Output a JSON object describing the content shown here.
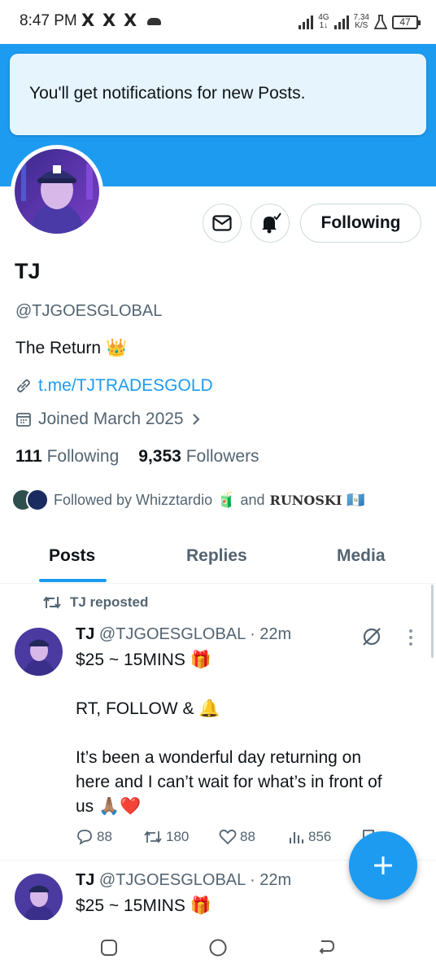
{
  "status_bar": {
    "time": "8:47 PM",
    "app_icons": [
      "X",
      "X",
      "X"
    ],
    "network_top": "4G",
    "network_bottom": "1↓",
    "speed_value": "7.34",
    "speed_unit": "K/S",
    "battery": "47"
  },
  "toast": {
    "text": "You'll get notifications for new Posts."
  },
  "actions": {
    "following_label": "Following"
  },
  "profile": {
    "name": "TJ",
    "handle": "@TJGOESGLOBAL",
    "bio": "The Return",
    "bio_emoji": "👑",
    "link": "t.me/TJTRADESGOLD",
    "joined": "Joined March 2025",
    "following_count": "111",
    "following_label": "Following",
    "followers_count": "9,353",
    "followers_label": "Followers",
    "followed_by_prefix": "Followed by Whizztardio",
    "followed_by_emoji1": "🧃",
    "followed_by_and": "and",
    "followed_by_second": "RUNOSKI",
    "followed_by_flag": "🇬🇹"
  },
  "tabs": [
    {
      "label": "Posts",
      "active": true
    },
    {
      "label": "Replies",
      "active": false
    },
    {
      "label": "Media",
      "active": false
    }
  ],
  "posts": [
    {
      "repost_label": "TJ reposted",
      "author": "TJ",
      "handle_time": "@TJGOESGLOBAL · 22m",
      "line1": "$25 ~ 15MINS",
      "line1_emoji": "🎁",
      "line2": "RT, FOLLOW &",
      "line2_emoji": "🔔",
      "line3": "It’s been a wonderful day returning on",
      "line4": "here and I can’t wait for what’s in front of",
      "line5": "us",
      "line5_emoji": "🙏🏽❤️",
      "replies": "88",
      "reposts": "180",
      "likes": "88",
      "views": "856"
    },
    {
      "author": "TJ",
      "handle_time": "@TJGOESGLOBAL · 22m",
      "line1": "$25 ~ 15MINS",
      "line1_emoji": "🎁"
    }
  ],
  "icons": {
    "message": "envelope-icon",
    "notifications": "bell-check-icon",
    "link": "link-icon",
    "calendar": "calendar-icon",
    "repost": "repost-icon",
    "grok": "grok-icon",
    "more": "more-vertical-icon",
    "compose": "plus-icon"
  },
  "colors": {
    "accent": "#1d9bf0",
    "text": "#0f1419",
    "secondary": "#536471"
  }
}
